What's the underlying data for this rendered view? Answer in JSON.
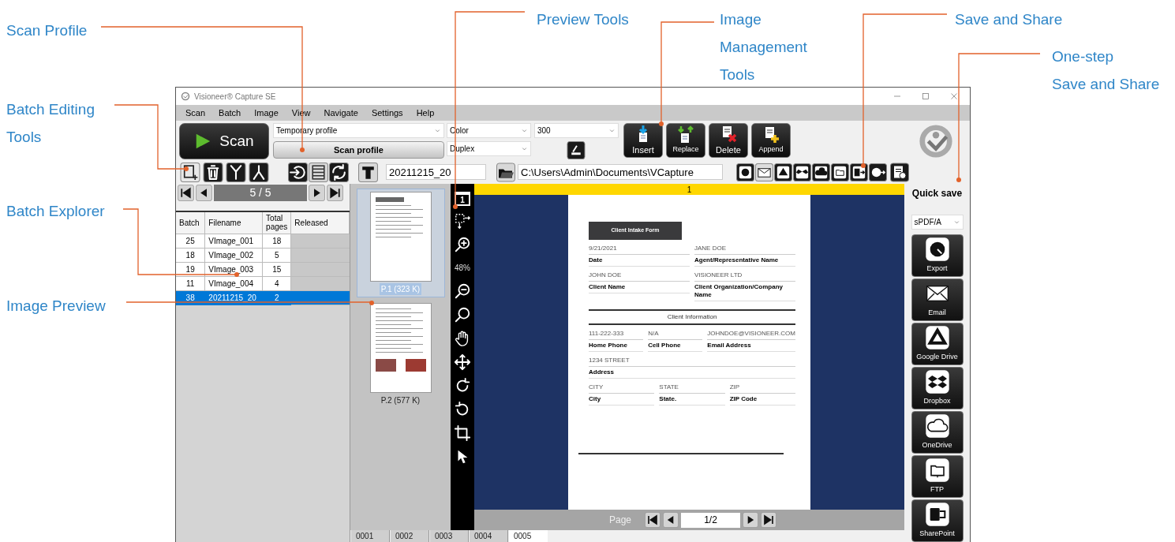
{
  "callouts": [
    {
      "lines": [
        "Scan Profile"
      ]
    },
    {
      "lines": [
        "Batch Editing",
        "Tools"
      ]
    },
    {
      "lines": [
        "Batch Explorer"
      ]
    },
    {
      "lines": [
        "Image Preview"
      ]
    },
    {
      "lines": [
        "Preview Tools"
      ]
    },
    {
      "lines": [
        "Image",
        "Management",
        "Tools"
      ]
    },
    {
      "lines": [
        "Save and Share"
      ]
    },
    {
      "lines": [
        "One-step",
        "Save and Share"
      ]
    }
  ],
  "window": {
    "title": "Visioneer® Capture SE"
  },
  "menu": [
    "Scan",
    "Batch",
    "Image",
    "View",
    "Navigate",
    "Settings",
    "Help"
  ],
  "toolbar": {
    "scan_button": "Scan",
    "profile": "Temporary profile",
    "scan_profile_button": "Scan profile",
    "color_mode": "Color",
    "sides": "Duplex",
    "resolution": "300",
    "image_tools": [
      {
        "label": "Insert",
        "kind": "insert"
      },
      {
        "label": "Replace",
        "kind": "replace"
      },
      {
        "label": "Delete",
        "kind": "delete"
      },
      {
        "label": "Append",
        "kind": "append"
      }
    ],
    "batch_name": "20211215_20",
    "path": "C:\\Users\\Admin\\Documents\\VCapture"
  },
  "batch_nav": "5 / 5",
  "batch_table": {
    "columns": [
      "Batch",
      "Filename",
      "Total pages",
      "Released"
    ],
    "rows": [
      {
        "cells": [
          "25",
          "VImage_001",
          "18"
        ],
        "selected": false
      },
      {
        "cells": [
          "18",
          "VImage_002",
          "5"
        ],
        "selected": false
      },
      {
        "cells": [
          "19",
          "VImage_003",
          "15"
        ],
        "selected": false
      },
      {
        "cells": [
          "11",
          "VImage_004",
          "4"
        ],
        "selected": false
      },
      {
        "cells": [
          "38",
          "20211215_20",
          "2"
        ],
        "selected": true
      }
    ]
  },
  "thumbnails": [
    {
      "caption": "P.1 (323 K)",
      "selected": true
    },
    {
      "caption": "P.2 (577 K)",
      "selected": false
    }
  ],
  "preview_tools": {
    "page_number": "1",
    "zoom": "48%"
  },
  "preview": {
    "page_marker": "1",
    "document": {
      "title": "Client Intake Form",
      "rows": [
        [
          {
            "value": "9/21/2021",
            "label": "Date"
          },
          {
            "value": "JANE DOE",
            "label": "Agent/Representative Name"
          }
        ],
        [
          {
            "value": "JOHN DOE",
            "label": "Client Name"
          },
          {
            "value": "VISIONEER LTD",
            "label": "Client Organization/Company Name"
          }
        ]
      ],
      "section": "Client Information",
      "rows_after": [
        [
          {
            "value": "111-222-333",
            "label": "Home Phone"
          },
          {
            "value": "N/A",
            "label": "Cell Phone"
          },
          {
            "value": "JOHNDOE@VISIONEER.COM",
            "label": "Email Address"
          }
        ],
        [
          {
            "value": "1234 STREET",
            "label": "Address"
          }
        ],
        [
          {
            "value": "CITY",
            "label": "City"
          },
          {
            "value": "STATE",
            "label": "State."
          },
          {
            "value": "ZIP",
            "label": "ZIP Code"
          }
        ]
      ]
    },
    "page_nav": {
      "label": "Page",
      "value": "1/2"
    }
  },
  "tabs": [
    {
      "label": "0001",
      "selected": false
    },
    {
      "label": "0002",
      "selected": false
    },
    {
      "label": "0003",
      "selected": false
    },
    {
      "label": "0004",
      "selected": false
    },
    {
      "label": "0005",
      "selected": true
    }
  ],
  "quick_save": {
    "title": "Quick save",
    "format": "sPDF/A",
    "buttons": [
      "Export",
      "Email",
      "Google Drive",
      "Dropbox",
      "OneDrive",
      "FTP",
      "SharePoint"
    ]
  }
}
